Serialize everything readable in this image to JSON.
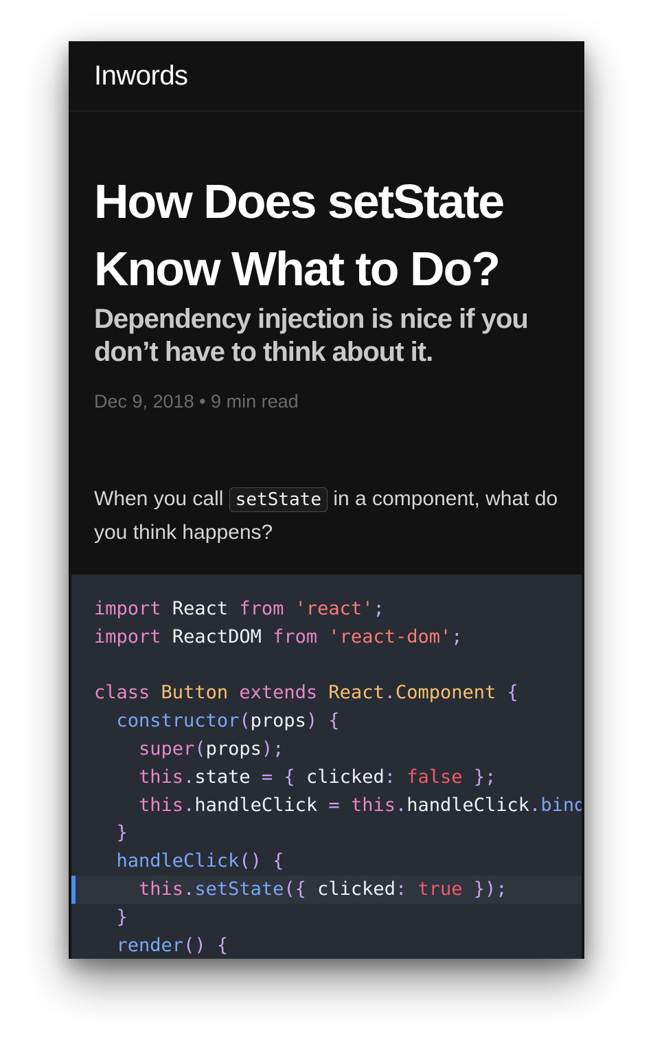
{
  "header": {
    "site_name": "Inwords"
  },
  "article": {
    "title": "How Does setState Know What to Do?",
    "subtitle": "Dependency injection is nice if you don’t have to think about it.",
    "meta": "Dec 9, 2018 • 9 min read",
    "intro_before": "When you call ",
    "intro_code": "setState",
    "intro_after": " in a component, what do you think happens?"
  },
  "code": {
    "lines": [
      {
        "highlighted": false,
        "tokens": [
          {
            "t": "import",
            "c": "kw"
          },
          {
            "t": " "
          },
          {
            "t": "React",
            "c": "id"
          },
          {
            "t": " "
          },
          {
            "t": "from",
            "c": "kw"
          },
          {
            "t": " "
          },
          {
            "t": "'react'",
            "c": "str"
          },
          {
            "t": ";",
            "c": "pn"
          }
        ]
      },
      {
        "highlighted": false,
        "tokens": [
          {
            "t": "import",
            "c": "kw"
          },
          {
            "t": " "
          },
          {
            "t": "ReactDOM",
            "c": "id"
          },
          {
            "t": " "
          },
          {
            "t": "from",
            "c": "kw"
          },
          {
            "t": " "
          },
          {
            "t": "'react-dom'",
            "c": "str"
          },
          {
            "t": ";",
            "c": "pn"
          }
        ]
      },
      {
        "highlighted": false,
        "tokens": []
      },
      {
        "highlighted": false,
        "tokens": [
          {
            "t": "class",
            "c": "kw"
          },
          {
            "t": " "
          },
          {
            "t": "Button",
            "c": "cls"
          },
          {
            "t": " "
          },
          {
            "t": "extends",
            "c": "kw"
          },
          {
            "t": " "
          },
          {
            "t": "React",
            "c": "cls"
          },
          {
            "t": ".",
            "c": "pn"
          },
          {
            "t": "Component",
            "c": "cls"
          },
          {
            "t": " "
          },
          {
            "t": "{",
            "c": "pn"
          }
        ]
      },
      {
        "highlighted": false,
        "tokens": [
          {
            "t": "  "
          },
          {
            "t": "constructor",
            "c": "fn"
          },
          {
            "t": "(",
            "c": "pn"
          },
          {
            "t": "props",
            "c": "id"
          },
          {
            "t": ")",
            "c": "pn"
          },
          {
            "t": " "
          },
          {
            "t": "{",
            "c": "pn"
          }
        ]
      },
      {
        "highlighted": false,
        "tokens": [
          {
            "t": "    "
          },
          {
            "t": "super",
            "c": "kw"
          },
          {
            "t": "(",
            "c": "pn"
          },
          {
            "t": "props",
            "c": "id"
          },
          {
            "t": ");",
            "c": "pn"
          }
        ]
      },
      {
        "highlighted": false,
        "tokens": [
          {
            "t": "    "
          },
          {
            "t": "this",
            "c": "kw"
          },
          {
            "t": ".",
            "c": "pn"
          },
          {
            "t": "state",
            "c": "id"
          },
          {
            "t": " "
          },
          {
            "t": "=",
            "c": "pn"
          },
          {
            "t": " "
          },
          {
            "t": "{",
            "c": "pn"
          },
          {
            "t": " "
          },
          {
            "t": "clicked",
            "c": "id"
          },
          {
            "t": ":",
            "c": "pn"
          },
          {
            "t": " "
          },
          {
            "t": "false",
            "c": "bool"
          },
          {
            "t": " "
          },
          {
            "t": "};",
            "c": "pn"
          }
        ]
      },
      {
        "highlighted": false,
        "tokens": [
          {
            "t": "    "
          },
          {
            "t": "this",
            "c": "kw"
          },
          {
            "t": ".",
            "c": "pn"
          },
          {
            "t": "handleClick",
            "c": "id"
          },
          {
            "t": " "
          },
          {
            "t": "=",
            "c": "pn"
          },
          {
            "t": " "
          },
          {
            "t": "this",
            "c": "kw"
          },
          {
            "t": ".",
            "c": "pn"
          },
          {
            "t": "handleClick",
            "c": "id"
          },
          {
            "t": ".",
            "c": "pn"
          },
          {
            "t": "bind",
            "c": "fn"
          }
        ]
      },
      {
        "highlighted": false,
        "tokens": [
          {
            "t": "  "
          },
          {
            "t": "}",
            "c": "pn"
          }
        ]
      },
      {
        "highlighted": false,
        "tokens": [
          {
            "t": "  "
          },
          {
            "t": "handleClick",
            "c": "fn"
          },
          {
            "t": "()",
            "c": "pn"
          },
          {
            "t": " "
          },
          {
            "t": "{",
            "c": "pn"
          }
        ]
      },
      {
        "highlighted": true,
        "tokens": [
          {
            "t": "    "
          },
          {
            "t": "this",
            "c": "kw"
          },
          {
            "t": ".",
            "c": "pn"
          },
          {
            "t": "setState",
            "c": "fn"
          },
          {
            "t": "({",
            "c": "pn"
          },
          {
            "t": " "
          },
          {
            "t": "clicked",
            "c": "id"
          },
          {
            "t": ":",
            "c": "pn"
          },
          {
            "t": " "
          },
          {
            "t": "true",
            "c": "bool"
          },
          {
            "t": " "
          },
          {
            "t": "});",
            "c": "pn"
          }
        ]
      },
      {
        "highlighted": false,
        "tokens": [
          {
            "t": "  "
          },
          {
            "t": "}",
            "c": "pn"
          }
        ]
      },
      {
        "highlighted": false,
        "tokens": [
          {
            "t": "  "
          },
          {
            "t": "render",
            "c": "fn"
          },
          {
            "t": "()",
            "c": "pn"
          },
          {
            "t": " "
          },
          {
            "t": "{",
            "c": "pn"
          }
        ]
      }
    ]
  }
}
